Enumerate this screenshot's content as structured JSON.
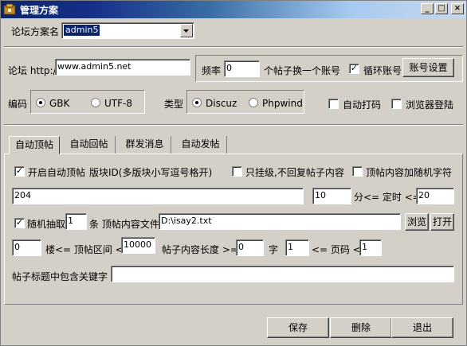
{
  "window": {
    "title": "管理方案",
    "minimize": "_",
    "maximize": "□",
    "close": "×"
  },
  "scheme": {
    "label": "论坛方案名",
    "value": "admin5"
  },
  "forum": {
    "label": "论坛 http://",
    "url": "www.admin5.net"
  },
  "freq": {
    "label": "频率",
    "value": "0",
    "suffix": "个帖子换一个账号",
    "cycle_label": "循环账号",
    "cycle_checked": true,
    "account_button": "账号设置"
  },
  "encoding": {
    "label": "编码",
    "options": [
      "GBK",
      "UTF-8"
    ],
    "selected": "GBK"
  },
  "type": {
    "label": "类型",
    "options": [
      "Discuz",
      "Phpwind"
    ],
    "selected": "Discuz"
  },
  "auto_code": {
    "label": "自动打码",
    "checked": false
  },
  "browser_login": {
    "label": "浏览器登陆",
    "checked": false
  },
  "tabs": [
    "自动顶帖",
    "自动回帖",
    "群发消息",
    "自动发帖"
  ],
  "active_tab": "自动顶帖",
  "top": {
    "enable_label": "开启自动顶帖",
    "enable_checked": true,
    "board_label": "版块ID(多版块小写逗号格开)",
    "only_hang_label": "只挂级,不回复帖子内容",
    "only_hang_checked": false,
    "random_char_label": "顶帖内容加随机字符",
    "random_char_checked": false,
    "board_ids": "204",
    "timer_min": "10",
    "timer_mid": "分<= 定时 <=",
    "timer_max": "20",
    "random_label": "随机抽取",
    "random_checked": true,
    "random_count": "1",
    "random_suffix": "条 顶帖内容文件",
    "file_path": "D:\\isay2.txt",
    "browse_button": "浏览",
    "open_button": "打开",
    "floor_min": "0",
    "floor_mid": "楼<= 顶帖区间 <=",
    "floor_max": "10000",
    "len_label": "帖子内容长度 >=",
    "len_value": "0",
    "len_unit": "字",
    "page_min": "1",
    "page_mid": "<= 页码 <=",
    "page_max": "1",
    "keyword_label": "帖子标题中包含关键字",
    "keyword_value": ""
  },
  "footer": {
    "save": "保存",
    "delete": "删除",
    "exit": "退出"
  }
}
